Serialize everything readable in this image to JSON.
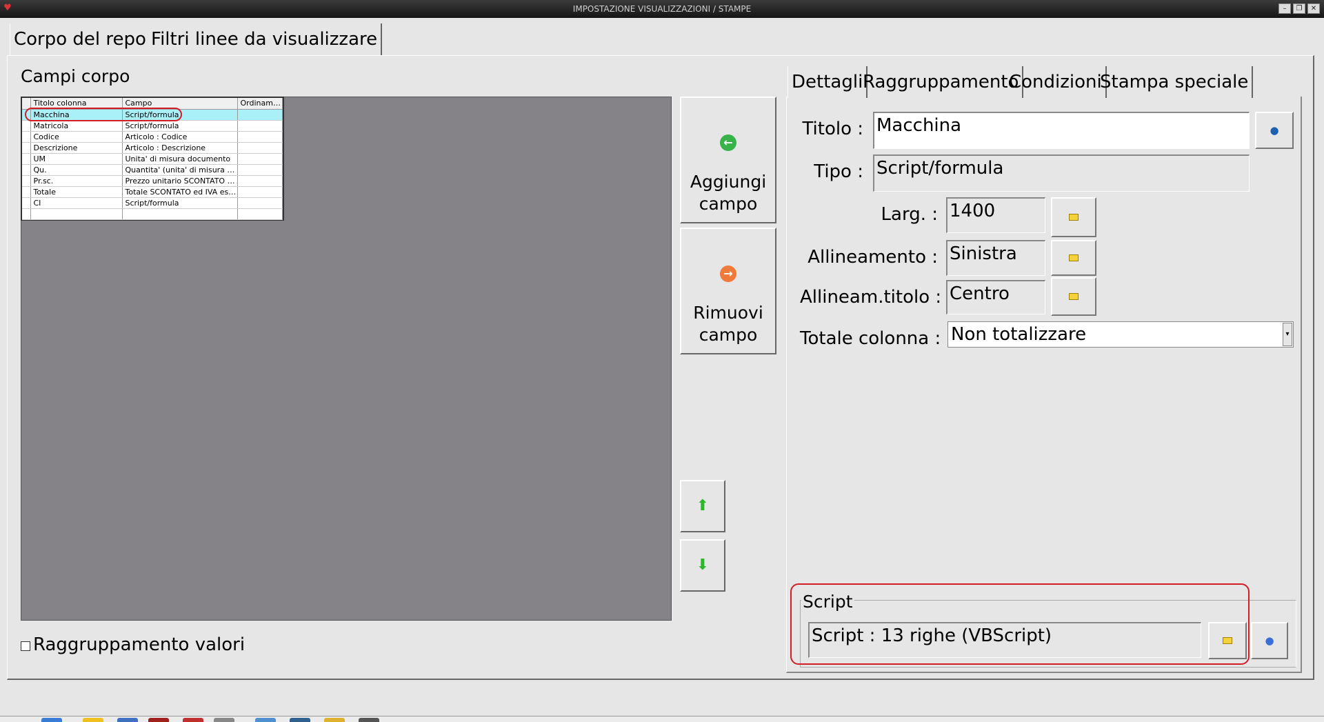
{
  "window": {
    "title": "IMPOSTAZIONE VISUALIZZAZIONI / STAMPE",
    "app_icon": "heart-icon",
    "controls": [
      "minimize-icon",
      "restore-icon",
      "close-icon"
    ]
  },
  "tabs": [
    {
      "label": "Corpo del report",
      "active": true
    },
    {
      "label": "Filtri linee da visualizzare",
      "active": false
    }
  ],
  "left": {
    "title": "Campi corpo",
    "grid": {
      "columns": [
        "Titolo colonna",
        "Campo",
        "Ordiname..."
      ],
      "rows": [
        {
          "titolo": "Macchina",
          "campo": "Script/formula",
          "ordinamento": "",
          "selected": true
        },
        {
          "titolo": "Matricola",
          "campo": "Script/formula",
          "ordinamento": ""
        },
        {
          "titolo": "Codice",
          "campo": "Articolo : Codice",
          "ordinamento": ""
        },
        {
          "titolo": "Descrizione",
          "campo": "Articolo : Descrizione",
          "ordinamento": ""
        },
        {
          "titolo": "UM",
          "campo": "Unita' di misura documento",
          "ordinamento": ""
        },
        {
          "titolo": "Qu.",
          "campo": "Quantita' (unita' di misura docu...",
          "ordinamento": ""
        },
        {
          "titolo": "Pr.sc.",
          "campo": "Prezzo unitario SCONTATO ed ...",
          "ordinamento": ""
        },
        {
          "titolo": "Totale",
          "campo": "Totale SCONTATO ed IVA escl...",
          "ordinamento": ""
        },
        {
          "titolo": "CI",
          "campo": "Script/formula",
          "ordinamento": ""
        },
        {
          "titolo": "",
          "campo": "",
          "ordinamento": ""
        }
      ]
    },
    "checkbox": {
      "label": "Raggruppamento valori",
      "checked": false
    }
  },
  "buttons": {
    "aggiungi": {
      "line1": "Aggiungi",
      "line2": "campo",
      "icon": "arrow-left-green-icon"
    },
    "rimuovi": {
      "line1": "Rimuovi",
      "line2": "campo",
      "icon": "arrow-right-orange-icon"
    },
    "move_up_icon": "arrow-up-icon",
    "move_down_icon": "arrow-down-icon"
  },
  "right": {
    "tabs": [
      {
        "label": "Dettagli",
        "active": true
      },
      {
        "label": "Raggruppamento",
        "active": false
      },
      {
        "label": "Condizioni",
        "active": false
      },
      {
        "label": "Stampa speciale",
        "active": false
      }
    ],
    "fields": {
      "titolo": {
        "label": "Titolo :",
        "value": "Macchina"
      },
      "tipo": {
        "label": "Tipo :",
        "value": "Script/formula"
      },
      "larg": {
        "label": "Larg. :",
        "value": "1400"
      },
      "allineamento": {
        "label": "Allineamento :",
        "value": "Sinistra"
      },
      "allineam_titolo": {
        "label": "Allineam.titolo :",
        "value": "Centro"
      },
      "totale_colonna": {
        "label": "Totale colonna :",
        "value": "Non totalizzare"
      }
    },
    "script": {
      "legend": "Script",
      "value": "Script : 13 righe (VBScript)"
    }
  },
  "colors": {
    "highlight": "#d31c24",
    "grid_selected": "#aaf0f8",
    "grid_area": "#858387"
  }
}
